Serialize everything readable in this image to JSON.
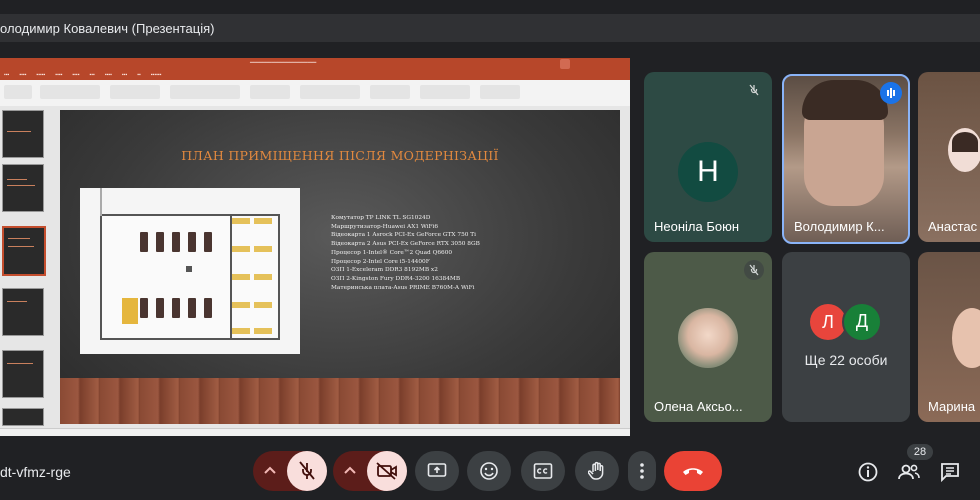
{
  "header": {
    "title": "олодимир Ковалевич (Презентація)"
  },
  "presentation": {
    "slide_title": "ПЛАН ПРИМІЩЕННЯ ПІСЛЯ МОДЕРНІЗАЦІЇ",
    "specs": [
      "Комутатор TP LINK TL SG1024D",
      "Маршрутизатор-Huawei AX1 WiFi6",
      "Відеокарта 1 Asrock PCI-Ex GeForce GTX 750 Ti",
      "Відеокарта 2 Asus PCI-Ex GeForce RTX 3050 8GB",
      "Процесор 1-Intel® Core™2 Quad Q6600",
      "Процесор 2-Intel Core i5-14400F",
      "ОЗП 1-Exceleram DDR3 8192MB x2",
      "ОЗП 2-Kingston Fury DDR4-3200 16384MB",
      "Материнська плата-Asus PRIME B760M-A WiFi"
    ]
  },
  "participants": [
    {
      "name": "Неоніла Боюн",
      "letter": "Н",
      "muted": true
    },
    {
      "name": "Володимир К...",
      "speaking": true
    },
    {
      "name": "Анастас"
    },
    {
      "name": "Олена Аксьо...",
      "muted": true
    },
    {
      "name": "Ще 22 особи",
      "letters": [
        "Л",
        "Д"
      ]
    },
    {
      "name": "Марина"
    }
  ],
  "meeting": {
    "code": "dt-vfmz-rge",
    "people_count": "28"
  },
  "colors": {
    "end_call": "#ea4335",
    "muted_bg": "#f9dedc",
    "accent": "#8ab4f8"
  }
}
